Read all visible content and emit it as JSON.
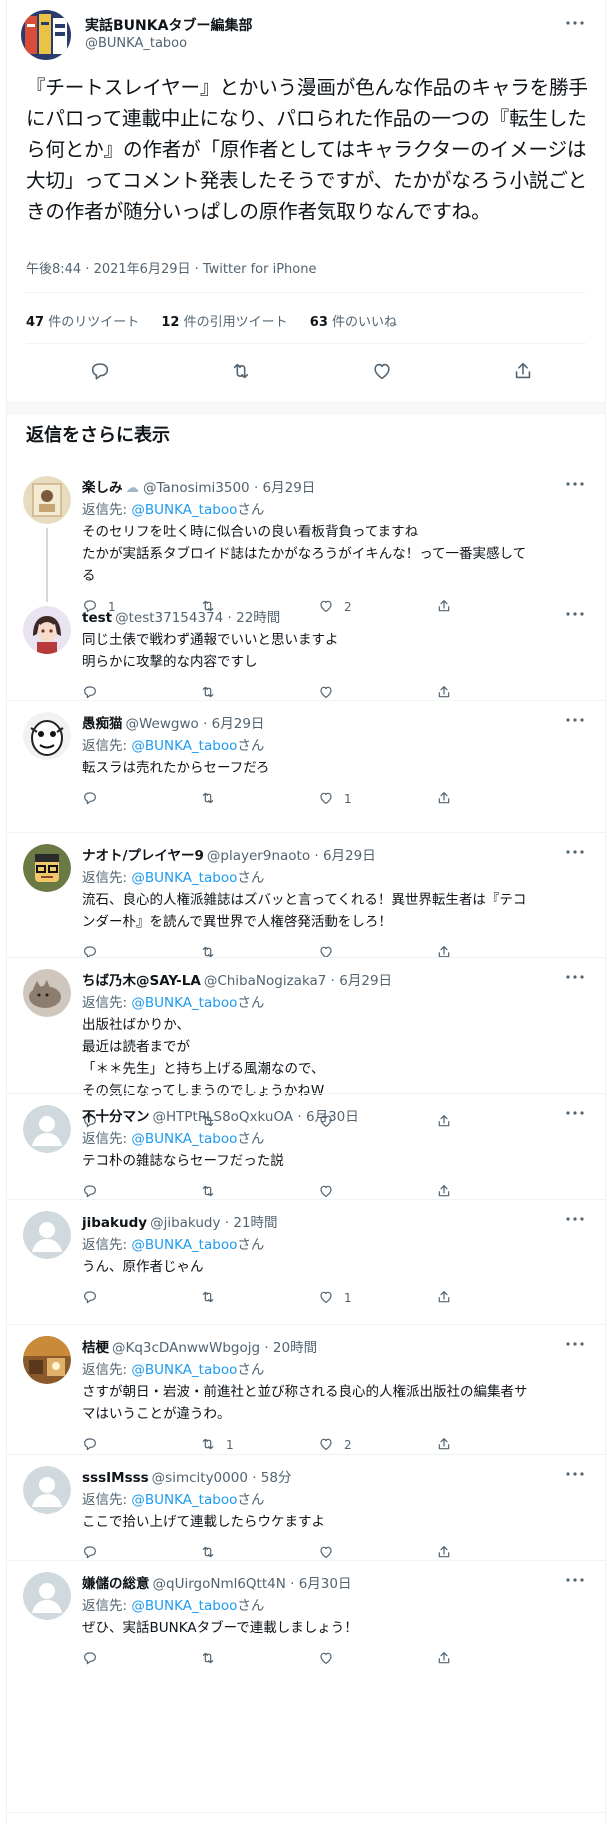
{
  "main": {
    "name": "実話BUNKAタブー編集部",
    "handle": "@BUNKA_taboo",
    "text": "『チートスレイヤー』とかいう漫画が色んな作品のキャラを勝手にパロって連載中止になり、パロられた作品の一つの『転生したら何とか』の作者が「原作者としてはキャラクターのイメージは大切」ってコメント発表したそうですが、たかがなろう小説ごときの作者が随分いっぱしの原作者気取りなんですね。",
    "meta": "午後8:44 · 2021年6月29日 · Twitter for iPhone",
    "stats": [
      {
        "count": "47",
        "label": "件のリツイート"
      },
      {
        "count": "12",
        "label": "件の引用ツイート"
      },
      {
        "count": "63",
        "label": "件のいいね"
      }
    ],
    "colors": {
      "accent": "#1d9bf0",
      "text": "#0f1419",
      "muted": "#536471",
      "border": "#eff3f4"
    }
  },
  "section_title": "返信をさらに表示",
  "reply_prefix": "返信先: ",
  "reply_suffix": "さん",
  "reply_target": "@BUNKA_taboo",
  "replies": [
    {
      "name": "楽しみ",
      "badge": "☁",
      "handle": "@Tanosimi3500",
      "time": "6月29日",
      "reply_to": true,
      "lines": [
        "そのセリフを吐く時に似合いの良い看板背負ってますね",
        "たかが実話系タブロイド誌はたかがなろうがイキんな！って一番実感して",
        "る"
      ],
      "reply_count": "1",
      "retweet_count": "",
      "like_count": "2",
      "avatar": "portrait-avatar"
    },
    {
      "name": "test",
      "badge": "",
      "handle": "@test37154374",
      "time": "22時間",
      "reply_to": false,
      "lines": [
        "同じ土俵で戦わず通報でいいと思いますよ",
        "明らかに攻撃的な内容ですし"
      ],
      "reply_count": "",
      "retweet_count": "",
      "like_count": "",
      "avatar": "anime-avatar"
    },
    {
      "name": "愚痴猫",
      "badge": "",
      "handle": "@Wewgwo",
      "time": "6月29日",
      "reply_to": true,
      "lines": [
        "転スラは売れたからセーフだろ"
      ],
      "reply_count": "",
      "retweet_count": "",
      "like_count": "1",
      "avatar": "mono-avatar"
    },
    {
      "name": "ナオト/プレイヤー9",
      "badge": "",
      "handle": "@player9naoto",
      "time": "6月29日",
      "reply_to": true,
      "lines": [
        "流石、良心的人権派雑誌はズバッと言ってくれる！異世界転生者は『テコ",
        "ンダー朴』を読んで異世界で人権啓発活動をしろ！"
      ],
      "reply_count": "",
      "retweet_count": "",
      "like_count": "",
      "avatar": "glasses-avatar"
    },
    {
      "name": "ちば乃木@SAY-LA",
      "badge": "",
      "handle": "@ChibaNogizaka7",
      "time": "6月29日",
      "reply_to": true,
      "lines": [
        "出版社ばかりか、",
        "最近は読者までが",
        "「＊＊先生」と持ち上げる風潮なので、",
        "その気になってしまうのでしょうかねW"
      ],
      "reply_count": "",
      "retweet_count": "",
      "like_count": "",
      "avatar": "cat-avatar"
    },
    {
      "name": "不十分マン",
      "badge": "",
      "handle": "@HTPtPLS8oQxkuOA",
      "time": "6月30日",
      "reply_to": true,
      "lines": [
        "テコ朴の雑誌ならセーフだった説"
      ],
      "reply_count": "",
      "retweet_count": "",
      "like_count": "",
      "avatar": "default-avatar"
    },
    {
      "name": "jibakudy",
      "badge": "",
      "handle": "@jibakudy",
      "time": "21時間",
      "reply_to": true,
      "lines": [
        "うん、原作者じゃん"
      ],
      "reply_count": "",
      "retweet_count": "",
      "like_count": "1",
      "avatar": "default-avatar"
    },
    {
      "name": "桔梗",
      "badge": "",
      "handle": "@Kq3cDAnwwWbgojg",
      "time": "20時間",
      "reply_to": true,
      "lines": [
        "さすが朝日・岩波・前進社と並び称される良心的人権派出版社の編集者サ",
        "マはいうことが違うわ。"
      ],
      "reply_count": "",
      "retweet_count": "1",
      "like_count": "2",
      "avatar": "photo-avatar"
    },
    {
      "name": "sssIMsss",
      "badge": "",
      "handle": "@simcity0000",
      "time": "58分",
      "reply_to": true,
      "lines": [
        "ここで拾い上げて連載したらウケますよ"
      ],
      "reply_count": "",
      "retweet_count": "",
      "like_count": "",
      "avatar": "default-avatar"
    },
    {
      "name": "嫌儲の総意",
      "badge": "",
      "handle": "@qUirgoNml6Qtt4N",
      "time": "6月30日",
      "reply_to": true,
      "lines": [
        "ぜひ、実話BUNKAタブーで連載しましょう！"
      ],
      "reply_count": "",
      "retweet_count": "",
      "like_count": "",
      "avatar": "default-avatar"
    }
  ]
}
